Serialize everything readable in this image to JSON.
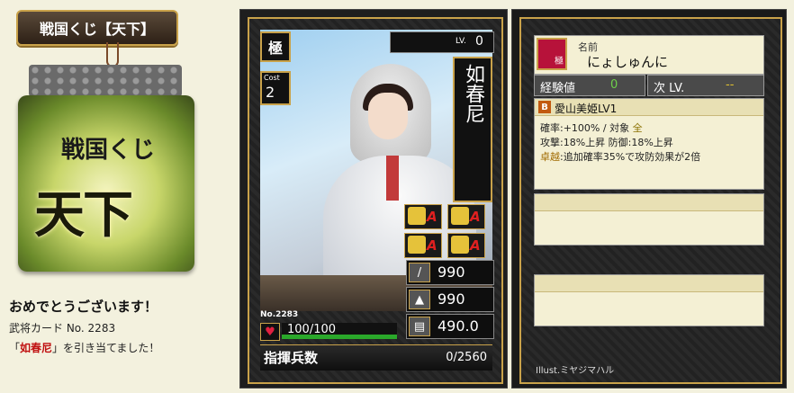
{
  "header": {
    "title": "戦国くじ【天下】"
  },
  "lottery_image": {
    "line1": "戦国くじ",
    "line2": "天下"
  },
  "message": {
    "congrats": "おめでとうございます！",
    "card_no_line": "武将カード No. 2283",
    "result_prefix": "「",
    "result_name": "如春尼",
    "result_suffix": "」を引き当てました！"
  },
  "card": {
    "rarity": "極",
    "cost_label": "Cost",
    "cost": "2",
    "lv_label": "LV.",
    "lv": "0",
    "name": "如春尼",
    "skill_grades": [
      "A",
      "A",
      "A",
      "A"
    ],
    "skill_icons": [
      "spear-soldier-icon",
      "cavalry-icon",
      "bow-icon",
      "siege-icon"
    ],
    "stats": [
      {
        "icon": "sword-icon",
        "value": "990"
      },
      {
        "icon": "helmet-icon",
        "value": "990"
      },
      {
        "icon": "scroll-icon",
        "value": "490.0"
      }
    ],
    "no": "No.2283",
    "hp": "100/100",
    "hp_ratio": 1.0,
    "troops_label": "指揮兵数",
    "troops_value": "0/2560"
  },
  "info": {
    "rank_badge": "極",
    "name_label": "名前",
    "name_value": "にょしゅんに",
    "exp_label": "経験値",
    "exp_value": "0",
    "next_label": "次 LV.",
    "next_value": "--",
    "skill": {
      "tag": "B",
      "name": "愛山美姫LV1",
      "line1_a": "確率:+100%  /  対象 ",
      "line1_b": "全",
      "line2": "攻撃:18%上昇  防御:18%上昇",
      "line3_a": "卓越",
      "line3_b": ":追加確率35%で攻防効果が2倍"
    },
    "illust": "Illust.ミヤジマハル"
  }
}
